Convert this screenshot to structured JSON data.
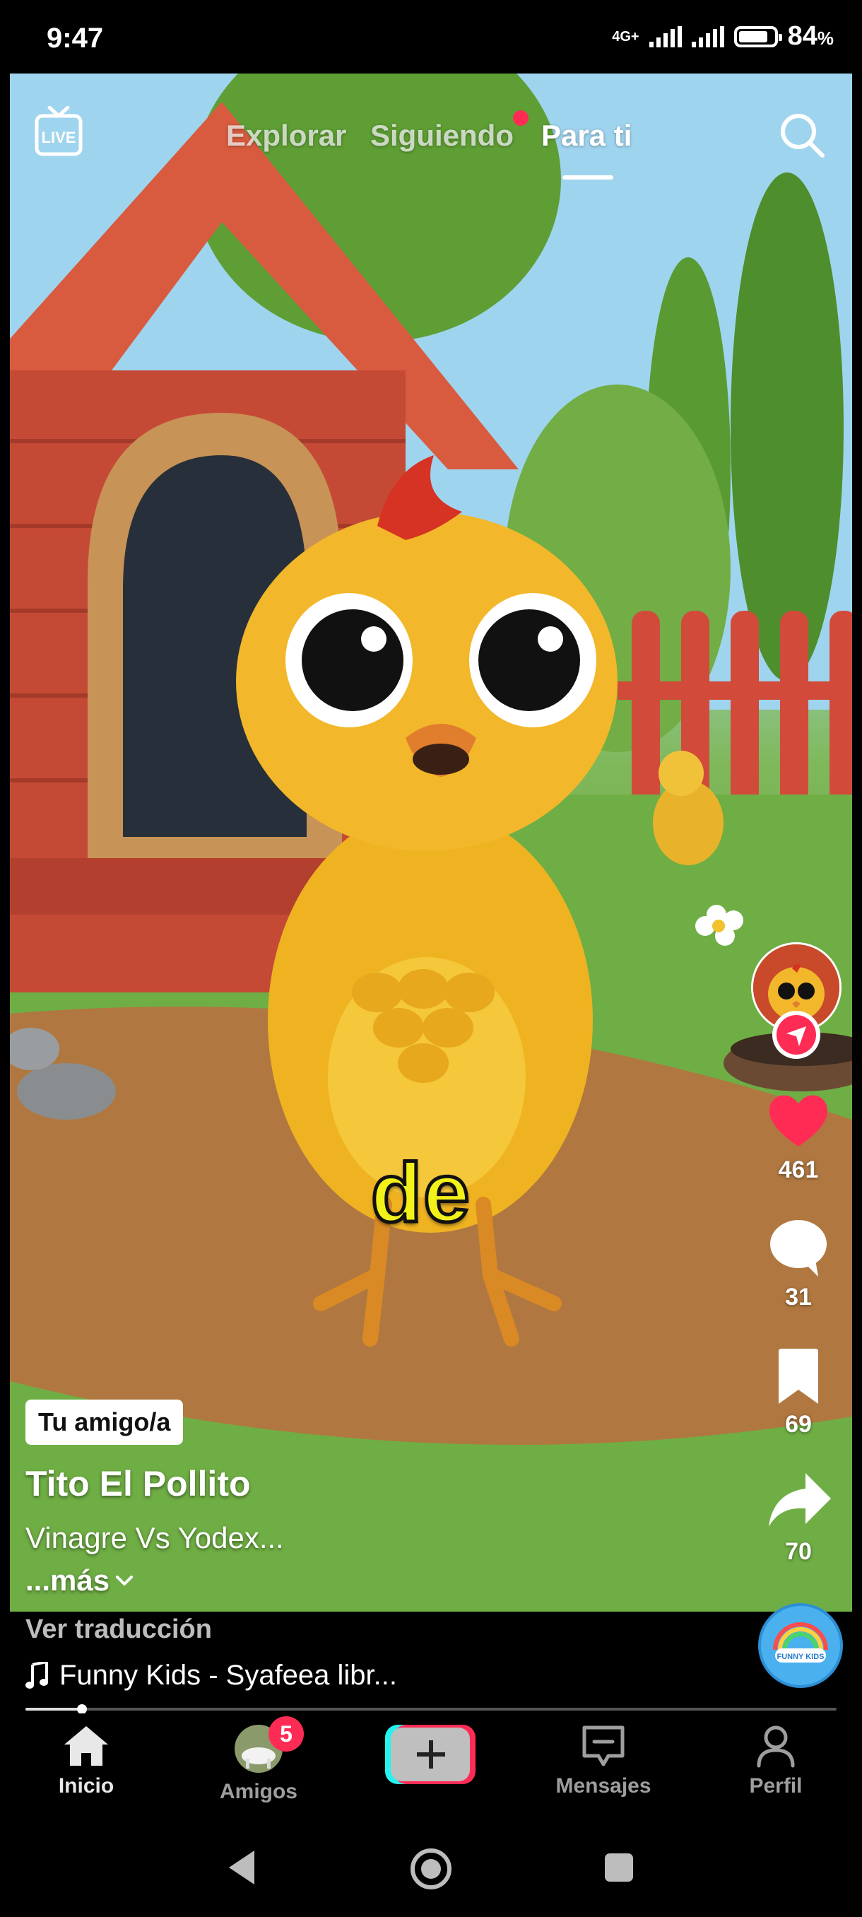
{
  "status_bar": {
    "time": "9:47",
    "network": "4G+",
    "battery": "84",
    "battery_unit": "%"
  },
  "top_nav": {
    "live_icon": "live-tv-icon",
    "tabs": [
      {
        "label": "Explorar"
      },
      {
        "label": "Siguiendo",
        "has_dot": true
      },
      {
        "label": "Para ti",
        "active": true
      }
    ],
    "search_icon": "search-icon"
  },
  "video": {
    "caption_word": "de"
  },
  "actions": {
    "likes": "461",
    "comments": "31",
    "saves": "69",
    "shares": "70",
    "like_color": "#fe2c55"
  },
  "post": {
    "friend_tag": "Tu amigo/a",
    "creator_name": "Tito El Pollito",
    "description": "Vinagre Vs Yodex...",
    "more_label": "...más",
    "translation_label": "Ver traducción",
    "music": "Funny Kids - Syafeea libr...",
    "music_disc_text": "FUNNY KIDS",
    "progress": 0.07
  },
  "bottom_nav": {
    "items": [
      {
        "label": "Inicio",
        "icon": "home-icon"
      },
      {
        "label": "Amigos",
        "icon": "friends-avatar",
        "badge": "5"
      },
      {
        "label": "",
        "icon": "plus-icon"
      },
      {
        "label": "Mensajes",
        "icon": "message-icon"
      },
      {
        "label": "Perfil",
        "icon": "profile-icon"
      }
    ]
  },
  "colors": {
    "accent": "#fe2c55",
    "caption": "#f2f21a"
  }
}
